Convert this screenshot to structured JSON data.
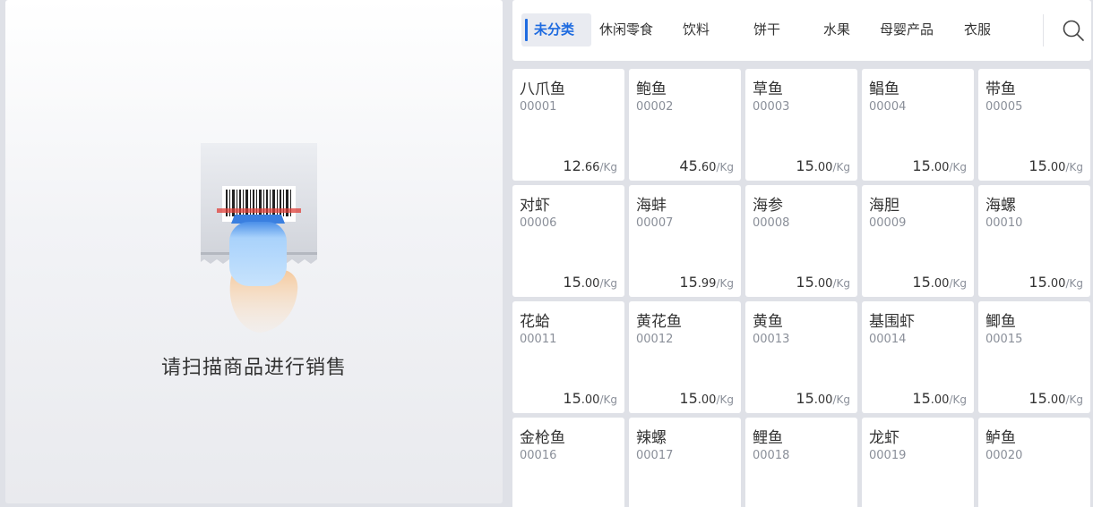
{
  "scan": {
    "prompt": "请扫描商品进行销售"
  },
  "categories": [
    {
      "label": "未分类",
      "active": true
    },
    {
      "label": "休闲零食"
    },
    {
      "label": "饮料"
    },
    {
      "label": "饼干"
    },
    {
      "label": "水果"
    },
    {
      "label": "母婴产品"
    },
    {
      "label": "衣服"
    }
  ],
  "icons": {
    "search": "search-icon",
    "scanner": "barcode-scanner-illustration"
  },
  "colors": {
    "accent": "#1e6be0",
    "background": "#dfe1e7",
    "card": "#ffffff"
  },
  "products": [
    {
      "name": "八爪鱼",
      "code": "00001",
      "price_int": "12",
      "price_dec": ".66",
      "unit": "/Kg"
    },
    {
      "name": "鲍鱼",
      "code": "00002",
      "price_int": "45",
      "price_dec": ".60",
      "unit": "/Kg"
    },
    {
      "name": "草鱼",
      "code": "00003",
      "price_int": "15",
      "price_dec": ".00",
      "unit": "/Kg"
    },
    {
      "name": "鲳鱼",
      "code": "00004",
      "price_int": "15",
      "price_dec": ".00",
      "unit": "/Kg"
    },
    {
      "name": "带鱼",
      "code": "00005",
      "price_int": "15",
      "price_dec": ".00",
      "unit": "/Kg"
    },
    {
      "name": "对虾",
      "code": "00006",
      "price_int": "15",
      "price_dec": ".00",
      "unit": "/Kg"
    },
    {
      "name": "海蚌",
      "code": "00007",
      "price_int": "15",
      "price_dec": ".99",
      "unit": "/Kg"
    },
    {
      "name": "海参",
      "code": "00008",
      "price_int": "15",
      "price_dec": ".00",
      "unit": "/Kg"
    },
    {
      "name": "海胆",
      "code": "00009",
      "price_int": "15",
      "price_dec": ".00",
      "unit": "/Kg"
    },
    {
      "name": "海螺",
      "code": "00010",
      "price_int": "15",
      "price_dec": ".00",
      "unit": "/Kg"
    },
    {
      "name": "花蛤",
      "code": "00011",
      "price_int": "15",
      "price_dec": ".00",
      "unit": "/Kg"
    },
    {
      "name": "黄花鱼",
      "code": "00012",
      "price_int": "15",
      "price_dec": ".00",
      "unit": "/Kg"
    },
    {
      "name": "黄鱼",
      "code": "00013",
      "price_int": "15",
      "price_dec": ".00",
      "unit": "/Kg"
    },
    {
      "name": "基围虾",
      "code": "00014",
      "price_int": "15",
      "price_dec": ".00",
      "unit": "/Kg"
    },
    {
      "name": "鲫鱼",
      "code": "00015",
      "price_int": "15",
      "price_dec": ".00",
      "unit": "/Kg"
    },
    {
      "name": "金枪鱼",
      "code": "00016"
    },
    {
      "name": "辣螺",
      "code": "00017"
    },
    {
      "name": "鲤鱼",
      "code": "00018"
    },
    {
      "name": "龙虾",
      "code": "00019"
    },
    {
      "name": "鲈鱼",
      "code": "00020"
    }
  ]
}
